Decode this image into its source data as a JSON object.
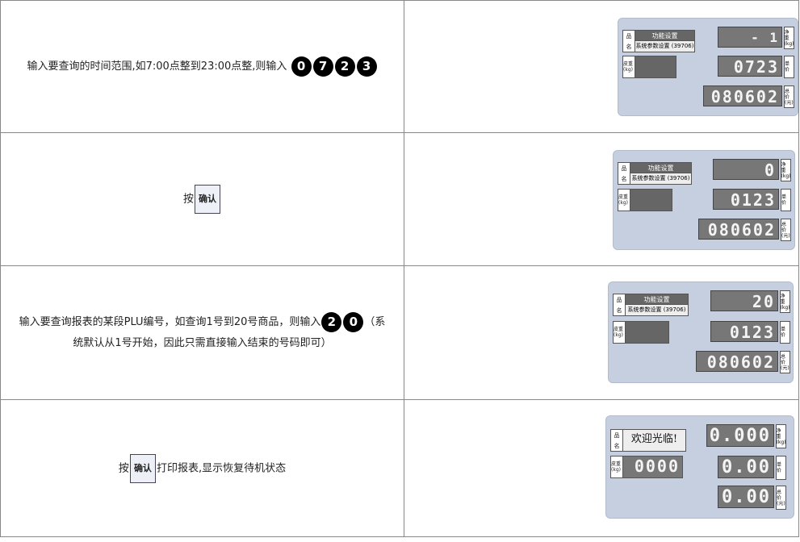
{
  "rows": [
    {
      "instruction": "输入要查询的时间范围,如7:00点整到23:00点整,则输入",
      "keys": [
        "0",
        "7",
        "2",
        "3"
      ],
      "display": {
        "name_top": "功能设置",
        "name_bottom": "系统参数设置 (39706)",
        "net": "- 1",
        "unit_price": "0723",
        "total": "080602"
      }
    },
    {
      "prefix": "按",
      "button": "确认",
      "display": {
        "name_top": "功能设置",
        "name_bottom": "系统参数设置 (39706)",
        "net": "0",
        "unit_price": "0123",
        "total": "080602"
      }
    },
    {
      "instruction": "输入要查询报表的某段PLU编号，如查询1号到20号商品，则输入",
      "keys": [
        "2",
        "0"
      ],
      "note_line1": "（系",
      "note_line2": "统默认从1号开始，因此只需直接输入结束的号码即可）",
      "display": {
        "name_top": "功能设置",
        "name_bottom": "系统参数设置 (39706)",
        "net": "20",
        "unit_price": "0123",
        "total": "080602"
      }
    },
    {
      "prefix": "按",
      "button": "确认",
      "suffix": "打印报表,显示恢复待机状态",
      "display": {
        "welcome": "欢迎光临!",
        "tare": "0000",
        "net": "0.000",
        "unit_price": "0.00",
        "total": "0.00"
      }
    }
  ],
  "labels": {
    "name": [
      "品",
      "名"
    ],
    "tare": "皮重(kg)",
    "net": "净重(kg)",
    "unit": "单价",
    "total": "总价(元)"
  }
}
